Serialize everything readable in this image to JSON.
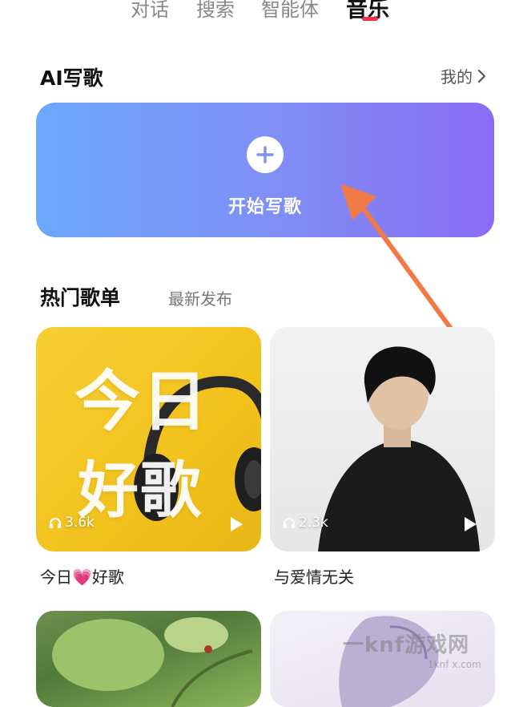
{
  "tabs": [
    "对话",
    "搜索",
    "智能体",
    "音乐"
  ],
  "active_tab": "音乐",
  "accent_color": "#f0304a",
  "ai_section": {
    "title": "AI写歌",
    "mine_label": "我的",
    "start_label": "开始写歌",
    "gradient": [
      "#6ca8fb",
      "#8a6cf4"
    ]
  },
  "hot_section": {
    "title": "热门歌单",
    "sub_tab": "最新发布"
  },
  "playlists": [
    {
      "cover_text": [
        "今日",
        "好歌"
      ],
      "plays": "3.6k",
      "title": "今日💗好歌"
    },
    {
      "plays": "2.3k",
      "title": "与爱情无关"
    }
  ],
  "watermark": {
    "text": "一knf游戏网",
    "sub": "1knf x.com"
  }
}
